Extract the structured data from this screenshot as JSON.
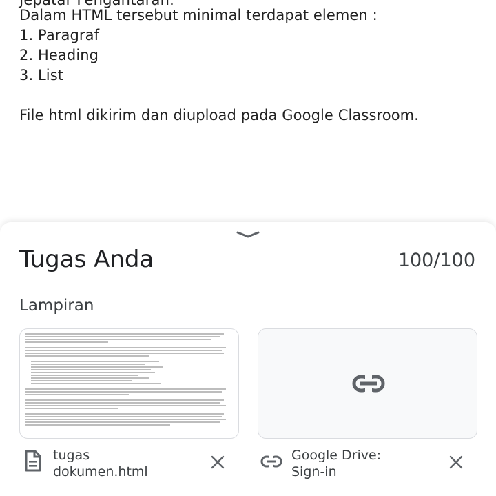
{
  "instructions": {
    "cut_line": "Jepatar Fengantaran.",
    "line_1": "Dalam HTML tersebut minimal terdapat elemen :",
    "list": [
      "1. Paragraf",
      "2. Heading",
      "3. List"
    ],
    "line_upload": "File html dikirim dan diupload pada Google Classroom."
  },
  "sheet": {
    "title": "Tugas Anda",
    "grade": "100/100",
    "attachments_label": "Lampiran"
  },
  "attachments": [
    {
      "name_line1": "tugas",
      "name_line2": "dokumen.html",
      "icon": "document-icon"
    },
    {
      "name_line1": "Google Drive:",
      "name_line2": "Sign-in",
      "icon": "link-icon"
    }
  ],
  "colors": {
    "text": "#222222",
    "secondary_text": "#3c4043",
    "card_border": "#dadce0",
    "link_card_bg": "#f8f9fa"
  }
}
